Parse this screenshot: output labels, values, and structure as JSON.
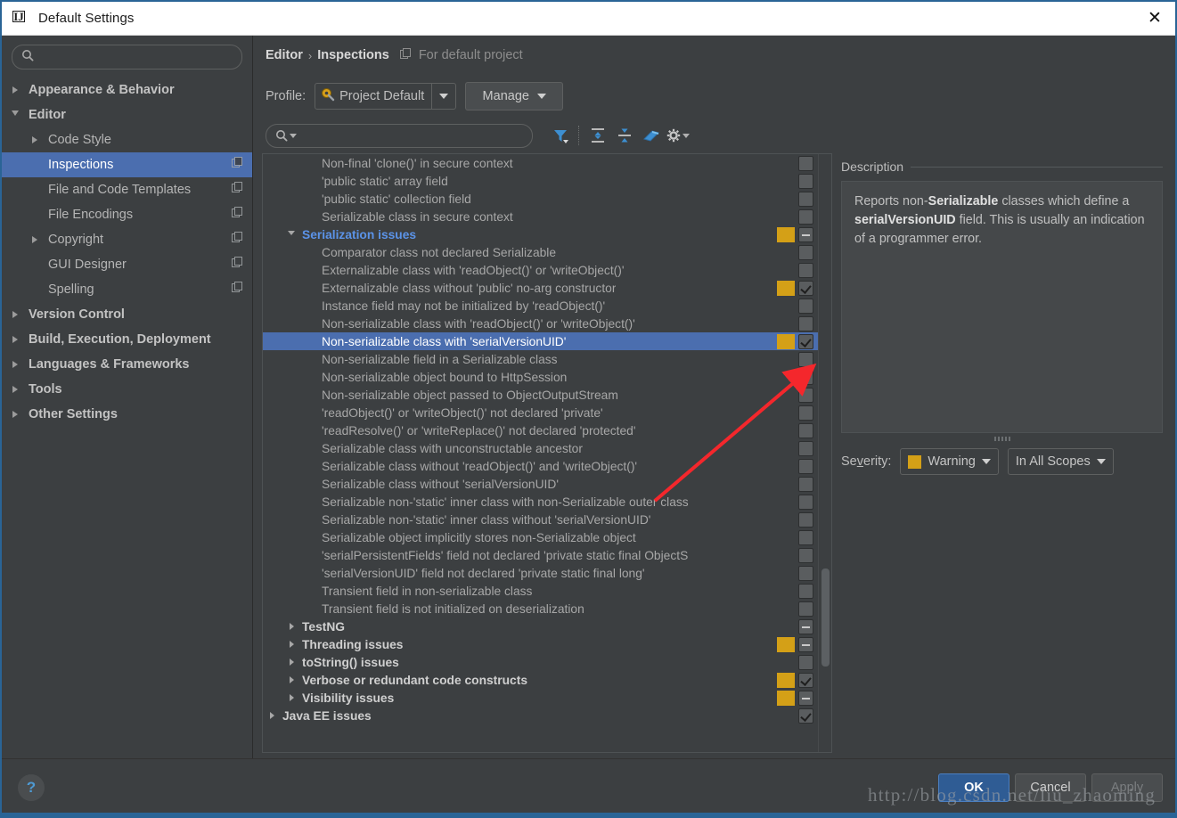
{
  "window": {
    "title": "Default Settings",
    "app_icon": "intellij-idea-icon",
    "close_label": "✕"
  },
  "sidebar": {
    "search": {
      "placeholder": "",
      "value": "",
      "icon": "search-icon"
    },
    "items": [
      {
        "label": "Appearance & Behavior",
        "level": 0,
        "bold": true,
        "arrow": "collapsed",
        "copy_icon": false
      },
      {
        "label": "Editor",
        "level": 0,
        "bold": true,
        "arrow": "expanded",
        "copy_icon": false
      },
      {
        "label": "Code Style",
        "level": 1,
        "bold": false,
        "arrow": "collapsed",
        "copy_icon": false
      },
      {
        "label": "Inspections",
        "level": 1,
        "bold": false,
        "arrow": "none",
        "copy_icon": true,
        "selected": true
      },
      {
        "label": "File and Code Templates",
        "level": 1,
        "bold": false,
        "arrow": "none",
        "copy_icon": true
      },
      {
        "label": "File Encodings",
        "level": 1,
        "bold": false,
        "arrow": "none",
        "copy_icon": true
      },
      {
        "label": "Copyright",
        "level": 1,
        "bold": false,
        "arrow": "collapsed",
        "copy_icon": true
      },
      {
        "label": "GUI Designer",
        "level": 1,
        "bold": false,
        "arrow": "none",
        "copy_icon": true
      },
      {
        "label": "Spelling",
        "level": 1,
        "bold": false,
        "arrow": "none",
        "copy_icon": true
      },
      {
        "label": "Version Control",
        "level": 0,
        "bold": true,
        "arrow": "collapsed",
        "copy_icon": false
      },
      {
        "label": "Build, Execution, Deployment",
        "level": 0,
        "bold": true,
        "arrow": "collapsed",
        "copy_icon": false
      },
      {
        "label": "Languages & Frameworks",
        "level": 0,
        "bold": true,
        "arrow": "collapsed",
        "copy_icon": false
      },
      {
        "label": "Tools",
        "level": 0,
        "bold": true,
        "arrow": "collapsed",
        "copy_icon": false
      },
      {
        "label": "Other Settings",
        "level": 0,
        "bold": true,
        "arrow": "collapsed",
        "copy_icon": false
      }
    ]
  },
  "breadcrumb": {
    "root": "Editor",
    "separator": "›",
    "current": "Inspections",
    "scope_icon": "copy-icon",
    "note": "For default project"
  },
  "profile": {
    "label": "Profile:",
    "icon": "gear-wrench-icon",
    "value": "Project Default",
    "manage_label": "Manage"
  },
  "inspection_toolbar": {
    "search": {
      "placeholder": "",
      "value": "",
      "icon": "search-dropdown-icon"
    },
    "buttons": [
      {
        "name": "filter-icon",
        "title": "Filter inspections"
      },
      {
        "name": "expand-all-icon",
        "title": "Expand all"
      },
      {
        "name": "collapse-all-icon",
        "title": "Collapse all"
      },
      {
        "name": "reset-eraser-icon",
        "title": "Reset to empty"
      },
      {
        "name": "gear-icon",
        "title": "Options"
      }
    ]
  },
  "inspection_list": {
    "rows": [
      {
        "label": "Non-final 'clone()' in secure context",
        "level": 2,
        "type": "leaf",
        "severity": "",
        "check": "none"
      },
      {
        "label": "'public static' array field",
        "level": 2,
        "type": "leaf",
        "severity": "",
        "check": "none"
      },
      {
        "label": "'public static' collection field",
        "level": 2,
        "type": "leaf",
        "severity": "",
        "check": "none"
      },
      {
        "label": "Serializable class in secure context",
        "level": 2,
        "type": "leaf",
        "severity": "",
        "check": "none"
      },
      {
        "label": "Serialization issues",
        "level": 1,
        "type": "category",
        "arrow": "expanded",
        "highlight": "blue",
        "severity": "#d4a017",
        "check": "dash"
      },
      {
        "label": "Comparator class not declared Serializable",
        "level": 2,
        "type": "leaf",
        "severity": "",
        "check": "none"
      },
      {
        "label": "Externalizable class with 'readObject()' or 'writeObject()'",
        "level": 2,
        "type": "leaf",
        "severity": "",
        "check": "none"
      },
      {
        "label": "Externalizable class without 'public' no-arg constructor",
        "level": 2,
        "type": "leaf",
        "severity": "#d4a017",
        "check": "check"
      },
      {
        "label": "Instance field may not be initialized by 'readObject()'",
        "level": 2,
        "type": "leaf",
        "severity": "",
        "check": "none"
      },
      {
        "label": "Non-serializable class with 'readObject()' or 'writeObject()'",
        "level": 2,
        "type": "leaf",
        "severity": "",
        "check": "none"
      },
      {
        "label": "Non-serializable class with 'serialVersionUID'",
        "level": 2,
        "type": "leaf",
        "severity": "#d4a017",
        "check": "check",
        "selected": true
      },
      {
        "label": "Non-serializable field in a Serializable class",
        "level": 2,
        "type": "leaf",
        "severity": "",
        "check": "none"
      },
      {
        "label": "Non-serializable object bound to HttpSession",
        "level": 2,
        "type": "leaf",
        "severity": "",
        "check": "none"
      },
      {
        "label": "Non-serializable object passed to ObjectOutputStream",
        "level": 2,
        "type": "leaf",
        "severity": "",
        "check": "none"
      },
      {
        "label": "'readObject()' or 'writeObject()' not declared 'private'",
        "level": 2,
        "type": "leaf",
        "severity": "",
        "check": "none"
      },
      {
        "label": "'readResolve()' or 'writeReplace()' not declared 'protected'",
        "level": 2,
        "type": "leaf",
        "severity": "",
        "check": "none"
      },
      {
        "label": "Serializable class with unconstructable ancestor",
        "level": 2,
        "type": "leaf",
        "severity": "",
        "check": "none"
      },
      {
        "label": "Serializable class without 'readObject()' and 'writeObject()'",
        "level": 2,
        "type": "leaf",
        "severity": "",
        "check": "none"
      },
      {
        "label": "Serializable class without 'serialVersionUID'",
        "level": 2,
        "type": "leaf",
        "severity": "",
        "check": "none"
      },
      {
        "label": "Serializable non-'static' inner class with non-Serializable outer class",
        "level": 2,
        "type": "leaf",
        "severity": "",
        "check": "none"
      },
      {
        "label": "Serializable non-'static' inner class without 'serialVersionUID'",
        "level": 2,
        "type": "leaf",
        "severity": "",
        "check": "none"
      },
      {
        "label": "Serializable object implicitly stores non-Serializable object",
        "level": 2,
        "type": "leaf",
        "severity": "",
        "check": "none"
      },
      {
        "label": "'serialPersistentFields' field not declared 'private static final ObjectS",
        "level": 2,
        "type": "leaf",
        "severity": "",
        "check": "none"
      },
      {
        "label": "'serialVersionUID' field not declared 'private static final long'",
        "level": 2,
        "type": "leaf",
        "severity": "",
        "check": "none"
      },
      {
        "label": "Transient field in non-serializable class",
        "level": 2,
        "type": "leaf",
        "severity": "",
        "check": "none"
      },
      {
        "label": "Transient field is not initialized on deserialization",
        "level": 2,
        "type": "leaf",
        "severity": "",
        "check": "none"
      },
      {
        "label": "TestNG",
        "level": 1,
        "type": "category",
        "arrow": "collapsed",
        "severity": "",
        "check": "dash"
      },
      {
        "label": "Threading issues",
        "level": 1,
        "type": "category",
        "arrow": "collapsed",
        "severity": "#d4a017",
        "check": "dash"
      },
      {
        "label": "toString() issues",
        "level": 1,
        "type": "category",
        "arrow": "collapsed",
        "severity": "",
        "check": "none"
      },
      {
        "label": "Verbose or redundant code constructs",
        "level": 1,
        "type": "category",
        "arrow": "collapsed",
        "severity": "#d4a017",
        "check": "check"
      },
      {
        "label": "Visibility issues",
        "level": 1,
        "type": "category",
        "arrow": "collapsed",
        "severity": "#d4a017",
        "check": "dash"
      },
      {
        "label": "Java EE issues",
        "level": 0,
        "type": "category",
        "arrow": "collapsed",
        "severity": "",
        "check": "check"
      }
    ]
  },
  "description": {
    "legend": "Description",
    "parts": [
      {
        "text": "Reports non-",
        "bold": false
      },
      {
        "text": "Serializable",
        "bold": true
      },
      {
        "text": " classes which define a ",
        "bold": false
      },
      {
        "text": "serialVersionUID",
        "bold": true
      },
      {
        "text": " field. This is usually an indication of a programmer error.",
        "bold": false
      }
    ]
  },
  "severity": {
    "label_pre": "Se",
    "label_mnemonic": "v",
    "label_post": "erity:",
    "value": "Warning",
    "swatch_color": "#d4a017",
    "scope_value": "In All Scopes"
  },
  "footer": {
    "help_label": "?",
    "ok_label": "OK",
    "cancel_label": "Cancel",
    "apply_label": "Apply"
  },
  "watermark": {
    "text": "http://blog.csdn.net/liu_zhaoming"
  }
}
